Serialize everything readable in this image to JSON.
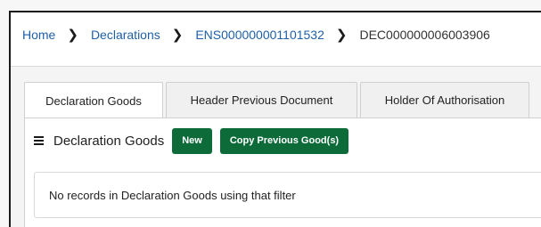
{
  "breadcrumb": {
    "items": [
      "Home",
      "Declarations",
      "ENS000000001101532"
    ],
    "current": "DEC000000006003906"
  },
  "tabs": [
    {
      "label": "Declaration Goods",
      "active": true
    },
    {
      "label": "Header Previous Document",
      "active": false
    },
    {
      "label": "Holder Of Authorisation",
      "active": false
    }
  ],
  "section": {
    "title": "Declaration Goods",
    "new_button": "New",
    "copy_button": "Copy Previous Good(s)"
  },
  "empty_message": "No records in Declaration Goods using that filter",
  "colors": {
    "link": "#1f5fa8",
    "button": "#0d6b3a"
  }
}
